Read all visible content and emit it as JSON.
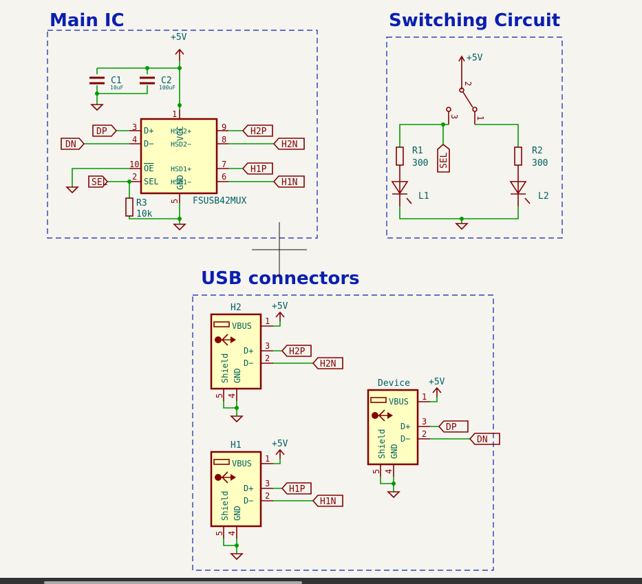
{
  "sections": {
    "main_ic": "Main IC",
    "switching": "Switching Circuit",
    "usb": "USB connectors"
  },
  "power": "+5V",
  "main_ic": {
    "ref": "FSUSB42MUX",
    "left_pins": [
      {
        "num": "3",
        "name": "D+",
        "label": "DP"
      },
      {
        "num": "4",
        "name": "D−",
        "label": "DN"
      },
      {
        "num": "10",
        "name": "OE"
      },
      {
        "num": "2",
        "name": "SEL",
        "label": "SEL"
      }
    ],
    "right_pins": [
      {
        "num": "9",
        "name": "HSD2+",
        "label": "H2P"
      },
      {
        "num": "8",
        "name": "HSD2−",
        "label": "H2N"
      },
      {
        "num": "7",
        "name": "HSD1+",
        "label": "H1P"
      },
      {
        "num": "6",
        "name": "HSD1−",
        "label": "H1N"
      }
    ],
    "vcc": {
      "num": "1",
      "name": "VCC"
    },
    "gnd": {
      "num": "5",
      "name": "GND"
    },
    "c1": {
      "ref": "C1",
      "value": "10uF"
    },
    "c2": {
      "ref": "C2",
      "value": "100uF"
    },
    "r3": {
      "ref": "R3",
      "value": "10k"
    }
  },
  "switching": {
    "sw_pins": [
      "2",
      "3",
      "1"
    ],
    "sel_label": "SEL",
    "r1": {
      "ref": "R1",
      "value": "300"
    },
    "r2": {
      "ref": "R2",
      "value": "300"
    },
    "l1": "L1",
    "l2": "L2"
  },
  "connectors": [
    {
      "ref": "H2",
      "dp": "H2P",
      "dn": "H2N"
    },
    {
      "ref": "H1",
      "dp": "H1P",
      "dn": "H1N"
    },
    {
      "ref": "Device",
      "dp": "DP",
      "dn": "DN"
    }
  ],
  "usb_pins": {
    "vbus": "VBUS",
    "dp": "D+",
    "dn": "D−",
    "shield": "Shield",
    "gnd": "GND",
    "n1": "1",
    "n2": "2",
    "n3": "3",
    "n4": "4",
    "n5": "5"
  }
}
